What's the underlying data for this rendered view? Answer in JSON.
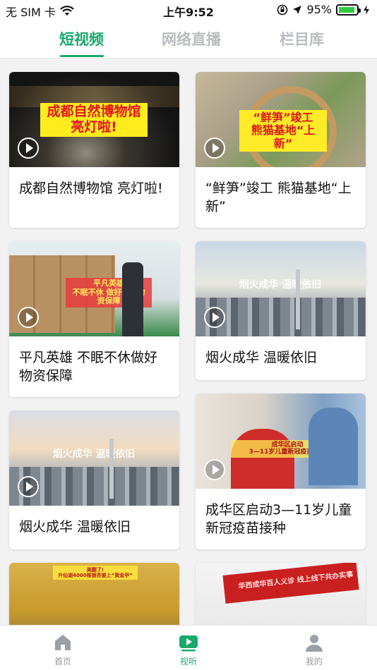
{
  "status_bar": {
    "carrier": "无 SIM 卡",
    "time": "上午9:52",
    "battery": "95%"
  },
  "tabs": [
    {
      "label": "短视频",
      "active": true
    },
    {
      "label": "网络直播",
      "active": false
    },
    {
      "label": "栏目库",
      "active": false
    }
  ],
  "cards": [
    {
      "title": "成都自然博物馆 亮灯啦!",
      "thumb_caption": "成都自然博物馆\n亮灯啦!"
    },
    {
      "title": "“鲜笋”竣工 熊猫基地“上新”",
      "thumb_caption": "“鲜笋”竣工\n熊猫基地“上新”"
    },
    {
      "title": "平凡英雄 不眠不休做好物资保障",
      "thumb_caption": "平凡英雄\n不眠不休 做好抗疫物资保障"
    },
    {
      "title": "烟火成华 温暖依旧",
      "thumb_caption": "烟火成华 温暖依旧"
    },
    {
      "title": "烟火成华 温暖依旧",
      "thumb_caption": "烟火成华 温暖依旧"
    },
    {
      "title": "成华区启动3—11岁儿童新冠疫苗接种",
      "thumb_caption": "成华区启动\n3—11岁儿童新冠疫苗接种"
    },
    {
      "title": "",
      "thumb_caption": "美翻了!\n升仙湖4000株银杏披上“黄金甲”"
    },
    {
      "title": "",
      "thumb_caption": "华西成华百人义诊 线上线下共办实事"
    }
  ],
  "bottom_nav": [
    {
      "label": "首页",
      "icon": "home-icon",
      "active": false
    },
    {
      "label": "视听",
      "icon": "video-play-icon",
      "active": true
    },
    {
      "label": "我的",
      "icon": "user-icon",
      "active": false
    }
  ],
  "colors": {
    "accent": "#1aa86c",
    "inactive_tab": "#b9bcc0"
  }
}
